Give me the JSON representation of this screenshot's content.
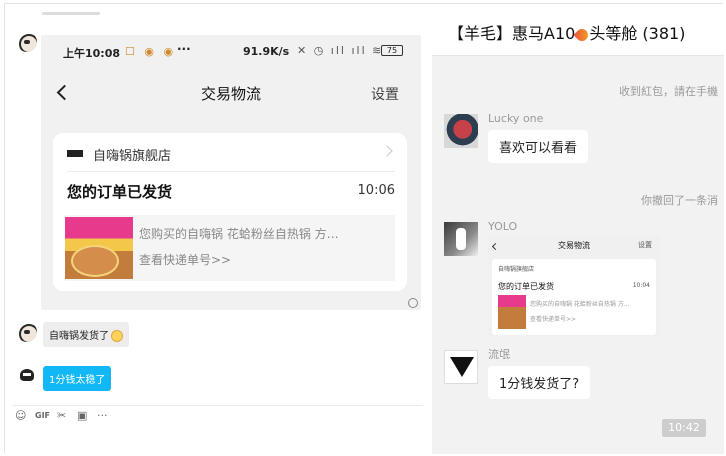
{
  "left": {
    "phone": {
      "status": {
        "time": "上午10:08",
        "indicators": "☐ ◉ ◉",
        "more": "···",
        "speed": "91.9K/s",
        "icons": "✕ ◷ ıll ıll ≋",
        "battery": "75"
      },
      "app_title": "交易物流",
      "settings_label": "设置",
      "card": {
        "store_name": "自嗨锅旗舰店",
        "ship_title": "您的订单已发货",
        "ship_time": "10:06",
        "product_text": "您购买的自嗨锅 花蛤粉丝自热锅 方…",
        "tracking_link": "查看快递单号>>"
      }
    },
    "messages": [
      {
        "text": "自嗨锅发货了"
      },
      {
        "text": "1分钱太稳了"
      }
    ],
    "toolbar": {
      "emoji_icon": "☺",
      "gif_icon": "GIF",
      "scissors_icon": "✂",
      "image_icon": "▣",
      "more_icon": "···"
    }
  },
  "right": {
    "title": "【羊毛】惠马A10",
    "title_suffix": "头等舱 (381)",
    "system_1": "收到紅包，請在手機",
    "system_2": "你撤回了一条消",
    "messages": [
      {
        "name": "Lucky one",
        "text": "喜欢可以看看"
      },
      {
        "name": "YOLO"
      },
      {
        "name": "流氓",
        "text": "1分钱发货了?"
      }
    ],
    "mini_shot": {
      "title": "交易物流",
      "settings": "设置",
      "store": "自嗨锅旗舰店",
      "ship_title": "您的订单已发货",
      "ship_time": "10:04",
      "product_text": "您购买的自嗨锅 花蛤粉丝自热锅 方...",
      "tracking_link": "查看快递单号>>"
    },
    "time_pill": "10:42"
  }
}
